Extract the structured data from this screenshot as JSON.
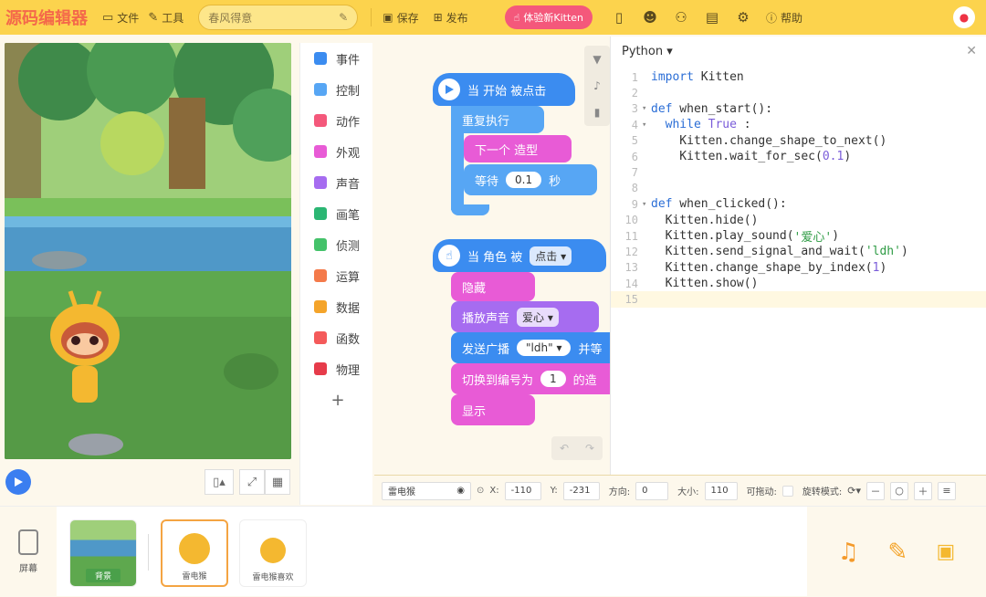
{
  "topbar": {
    "logo": "源码编辑器",
    "file_label": "文件",
    "tools_label": "工具",
    "project_name": "春风得意",
    "save_label": "保存",
    "publish_label": "发布",
    "try_label": "体验新Kitten",
    "help_label": "帮助"
  },
  "categories": [
    {
      "label": "事件",
      "color": "#3b8cf0"
    },
    {
      "label": "控制",
      "color": "#57a6f4"
    },
    {
      "label": "动作",
      "color": "#f4587b"
    },
    {
      "label": "外观",
      "color": "#e85bd6"
    },
    {
      "label": "声音",
      "color": "#a66cf0"
    },
    {
      "label": "画笔",
      "color": "#2bb673"
    },
    {
      "label": "侦测",
      "color": "#44c26a"
    },
    {
      "label": "运算",
      "color": "#f47a4a"
    },
    {
      "label": "数据",
      "color": "#f4a42a"
    },
    {
      "label": "函数",
      "color": "#f45a5a"
    },
    {
      "label": "物理",
      "color": "#e63b4a"
    }
  ],
  "add_category": "+",
  "blocks": {
    "when_start": "当 开始 被点击",
    "repeat": "重复执行",
    "next_shape": "下一个 造型",
    "wait_prefix": "等待",
    "wait_value": "0.1",
    "wait_suffix": "秒",
    "when_sprite": "当 角色 被",
    "click_option": "点击",
    "hide": "隐藏",
    "play_sound": "播放声音",
    "sound_option": "爱心",
    "broadcast": "发送广播",
    "broadcast_option": "\"ldh\"",
    "broadcast_suffix": "并等",
    "switch_shape": "切换到编号为",
    "switch_value": "1",
    "switch_suffix": "的造",
    "show": "显示"
  },
  "editor": {
    "language": "Python",
    "lines": [
      {
        "n": "1",
        "fold": "",
        "parts": [
          [
            "kw",
            "import"
          ],
          [
            "plain",
            " Kitten"
          ]
        ]
      },
      {
        "n": "2",
        "fold": "",
        "parts": []
      },
      {
        "n": "3",
        "fold": "▾",
        "parts": [
          [
            "kw",
            "def"
          ],
          [
            "plain",
            " when_start():"
          ]
        ]
      },
      {
        "n": "4",
        "fold": "▾",
        "parts": [
          [
            "plain",
            "  "
          ],
          [
            "kw",
            "while"
          ],
          [
            "plain",
            " "
          ],
          [
            "num",
            "True"
          ],
          [
            "plain",
            " :"
          ]
        ]
      },
      {
        "n": "5",
        "fold": "",
        "parts": [
          [
            "plain",
            "    Kitten.change_shape_to_next()"
          ]
        ]
      },
      {
        "n": "6",
        "fold": "",
        "parts": [
          [
            "plain",
            "    Kitten.wait_for_sec("
          ],
          [
            "num",
            "0.1"
          ],
          [
            "plain",
            ")"
          ]
        ]
      },
      {
        "n": "7",
        "fold": "",
        "parts": []
      },
      {
        "n": "8",
        "fold": "",
        "parts": []
      },
      {
        "n": "9",
        "fold": "▾",
        "parts": [
          [
            "kw",
            "def"
          ],
          [
            "plain",
            " when_clicked():"
          ]
        ]
      },
      {
        "n": "10",
        "fold": "",
        "parts": [
          [
            "plain",
            "  Kitten.hide()"
          ]
        ]
      },
      {
        "n": "11",
        "fold": "",
        "parts": [
          [
            "plain",
            "  Kitten.play_sound("
          ],
          [
            "str",
            "'爱心'"
          ],
          [
            "plain",
            ")"
          ]
        ]
      },
      {
        "n": "12",
        "fold": "",
        "parts": [
          [
            "plain",
            "  Kitten.send_signal_and_wait("
          ],
          [
            "str",
            "'ldh'"
          ],
          [
            "plain",
            ")"
          ]
        ]
      },
      {
        "n": "13",
        "fold": "",
        "parts": [
          [
            "plain",
            "  Kitten.change_shape_by_index("
          ],
          [
            "num",
            "1"
          ],
          [
            "plain",
            ")"
          ]
        ]
      },
      {
        "n": "14",
        "fold": "",
        "parts": [
          [
            "plain",
            "  Kitten.show()"
          ]
        ]
      },
      {
        "n": "15",
        "fold": "",
        "parts": []
      }
    ]
  },
  "props": {
    "sprite_name": "雷电猴",
    "x_label": "X:",
    "x_value": "-110",
    "y_label": "Y:",
    "y_value": "-231",
    "dir_label": "方向:",
    "dir_value": "0",
    "size_label": "大小:",
    "size_value": "110",
    "drag_label": "可拖动:",
    "rotate_label": "旋转模式:"
  },
  "bottom": {
    "screen_label": "屏幕",
    "background_label": "背景",
    "sprite1_label": "雷电猴",
    "sprite2_label": "雷电猴喜欢"
  }
}
